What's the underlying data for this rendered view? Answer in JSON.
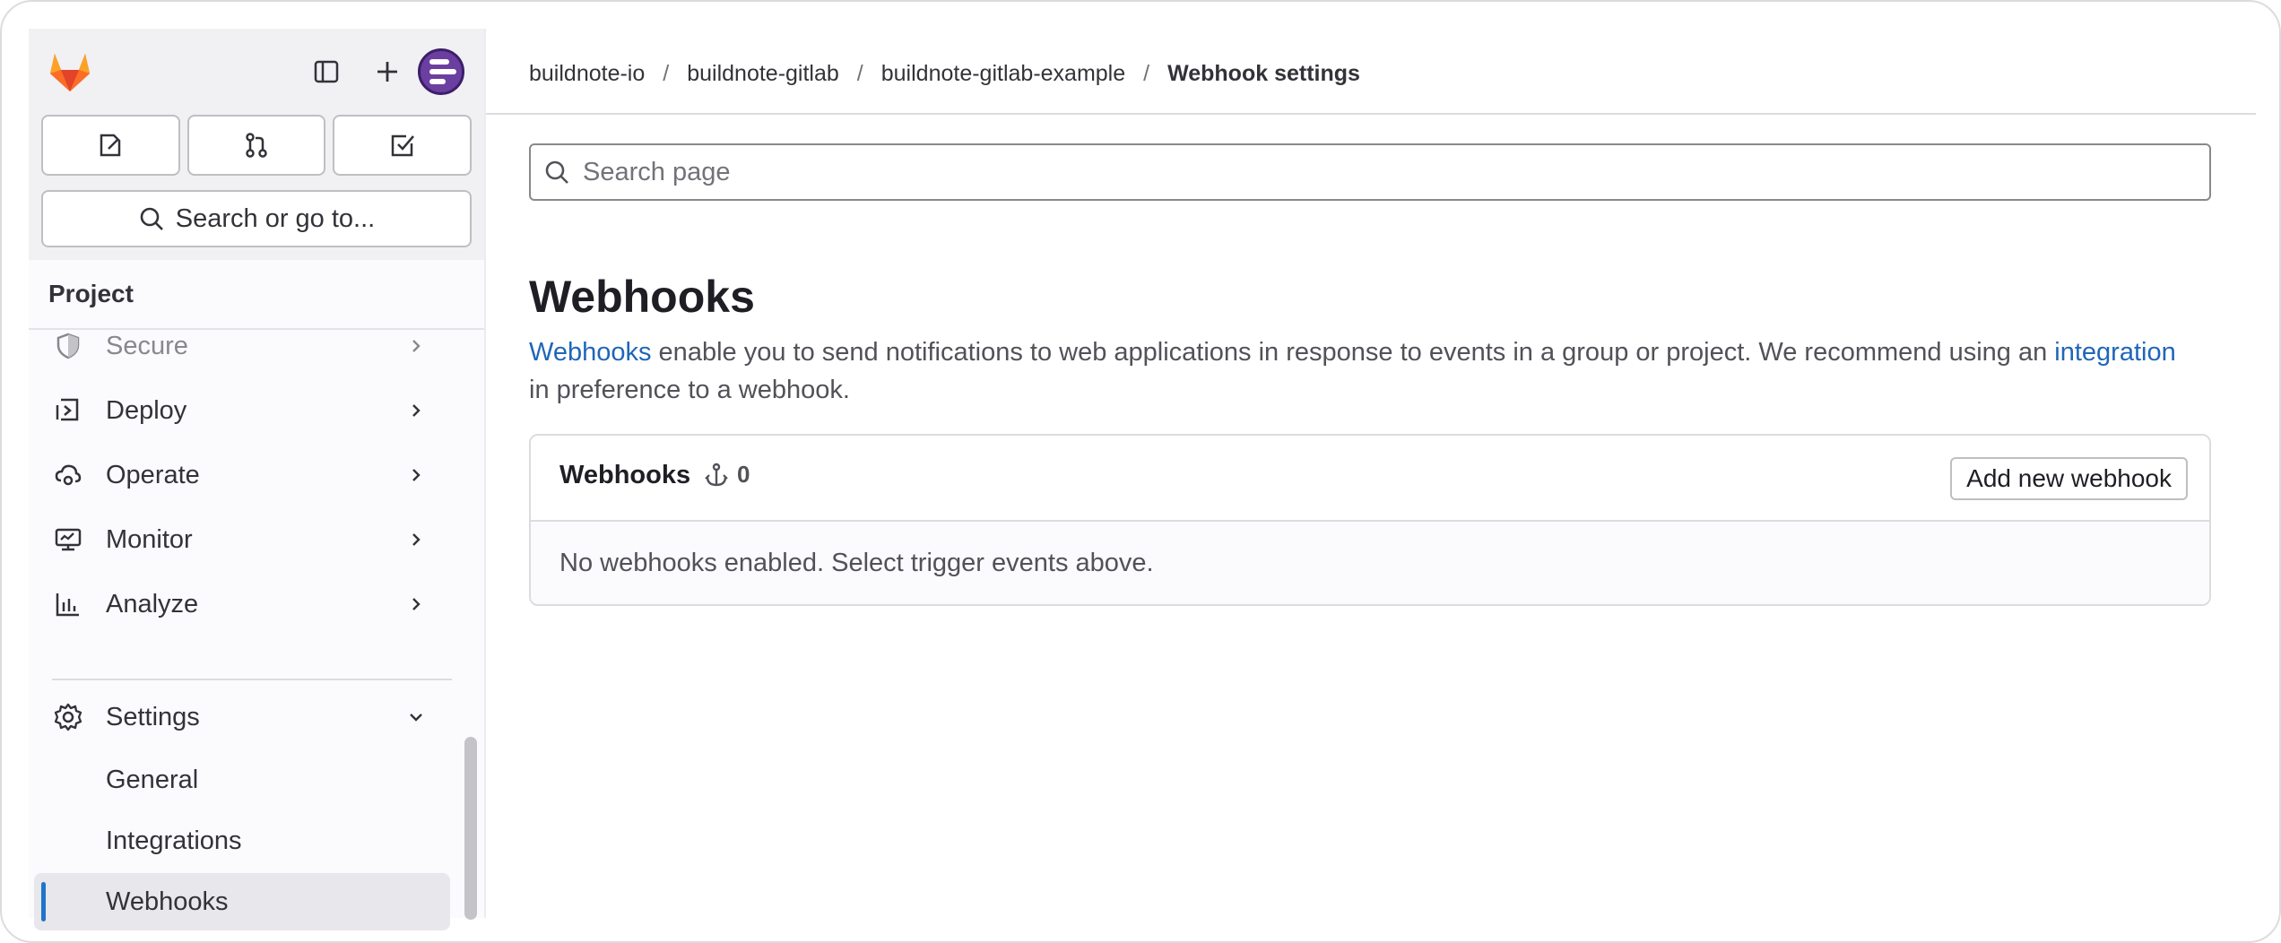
{
  "sidebar": {
    "section_label": "Project",
    "search_label": "Search or go to...",
    "items": [
      {
        "label": "Secure"
      },
      {
        "label": "Deploy"
      },
      {
        "label": "Operate"
      },
      {
        "label": "Monitor"
      },
      {
        "label": "Analyze"
      },
      {
        "label": "Settings"
      }
    ],
    "sub_items": [
      {
        "label": "General"
      },
      {
        "label": "Integrations"
      },
      {
        "label": "Webhooks"
      }
    ]
  },
  "breadcrumb": {
    "items": [
      "buildnote-io",
      "buildnote-gitlab",
      "buildnote-gitlab-example"
    ],
    "current": "Webhook settings",
    "separator": "/"
  },
  "search": {
    "placeholder": "Search page"
  },
  "page": {
    "title": "Webhooks",
    "desc_link1": "Webhooks",
    "desc_text1": " enable you to send notifications to web applications in response to events in a group or project. We recommend using an ",
    "desc_link2": "integration",
    "desc_text2": " in preference to a webhook."
  },
  "card": {
    "title": "Webhooks",
    "count": "0",
    "add_label": "Add new webhook",
    "empty": "No webhooks enabled. Select trigger events above."
  },
  "colors": {
    "accent": "#1f75cb",
    "link": "#1f66b8",
    "avatar": "#6b3fa0"
  }
}
